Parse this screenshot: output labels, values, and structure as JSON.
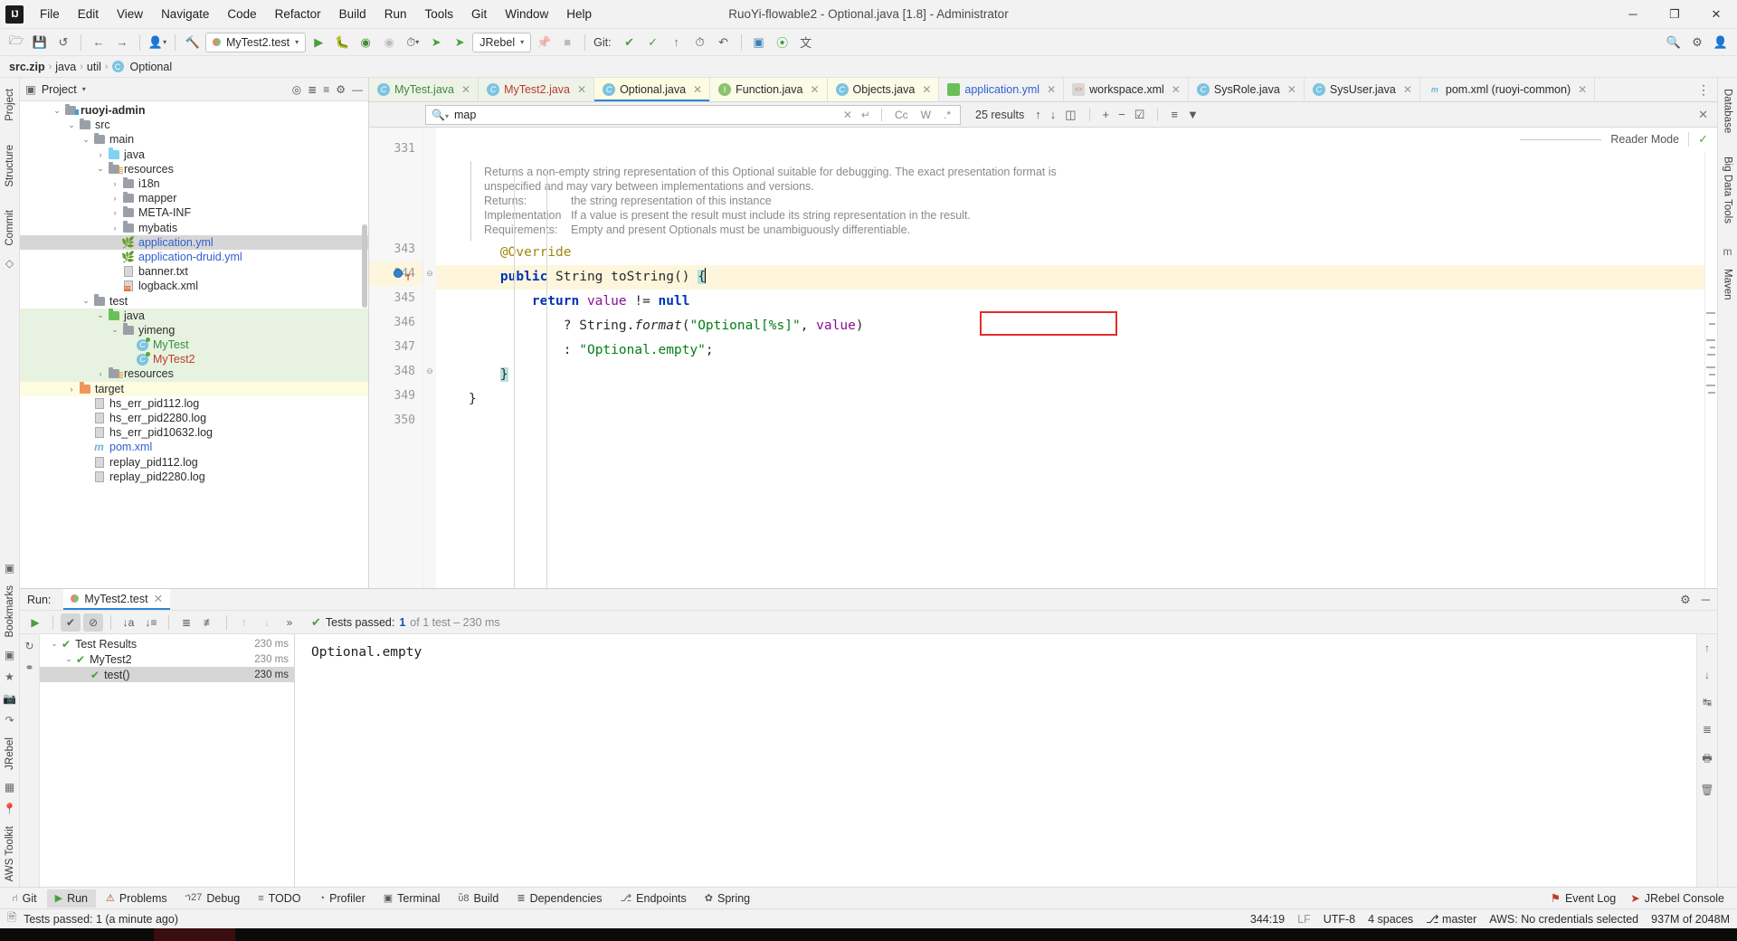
{
  "window": {
    "title": "RuoYi-flowable2 - Optional.java [1.8] - Administrator",
    "logo": "IJ",
    "minimize": "─",
    "maximize": "❐",
    "close": "✕"
  },
  "menubar": [
    "File",
    "Edit",
    "View",
    "Navigate",
    "Code",
    "Refactor",
    "Build",
    "Run",
    "Tools",
    "Git",
    "Window",
    "Help"
  ],
  "toolbar": {
    "open_icon": "open-folder-icon",
    "save_icon": "save-icon",
    "sync_icon": "sync-icon",
    "back_icon": "←",
    "forward_icon": "→",
    "profile_icon": "user-profile-icon",
    "build_icon": "hammer-icon",
    "run_config": "MyTest2.test",
    "run_icon": "▶",
    "debug_icon": "debug-bug-icon",
    "run_coverage_icon": "run-with-coverage-icon",
    "profile_run_icon": "profiler-icon",
    "rerun_icon": "rerun-clock-icon",
    "jrebel_run_icon": "jrebel-run-icon",
    "jrebel_debug_icon": "jrebel-debug-icon",
    "jrebel_label": "JRebel",
    "stop_icon": "■",
    "git_label": "Git:",
    "git_update_icon": "✔",
    "git_commit_icon": "✓",
    "git_push_icon": "↑",
    "git_history_icon": "history-icon",
    "git_rollback_icon": "↶",
    "search_everywhere_icon": "search-icon",
    "settings_icon": "gear-icon",
    "layout_icon": "layout-icon",
    "translate_icon": "translate-icon",
    "checkstyle_icon": "checkmark-circle-icon"
  },
  "breadcrumb": {
    "items": [
      "src.zip",
      "java",
      "util",
      "Optional"
    ],
    "separator": "›"
  },
  "left_strip": [
    "Project",
    "Structure",
    "Commit"
  ],
  "right_strip": [
    "Database",
    "Big Data Tools",
    "Maven"
  ],
  "bottom_left_strip": [
    "Bookmarks",
    "JRebel",
    "AWS Toolkit"
  ],
  "project_panel": {
    "title": "Project",
    "chevron": "▾",
    "icons": [
      "locate-icon",
      "collapse-all-icon",
      "expand-icon",
      "gear-icon",
      "hide-icon"
    ],
    "tree": [
      {
        "indent": 1,
        "arrow": "⌄",
        "icon": "folder-module",
        "label": "ruoyi-admin",
        "style": "bold",
        "color": "dark",
        "state": "normal"
      },
      {
        "indent": 2,
        "arrow": "⌄",
        "icon": "folder",
        "label": "src",
        "color": "dark",
        "state": "normal"
      },
      {
        "indent": 3,
        "arrow": "⌄",
        "icon": "folder",
        "label": "main",
        "color": "dark",
        "state": "normal"
      },
      {
        "indent": 4,
        "arrow": "›",
        "icon": "folder-blue",
        "label": "java",
        "color": "dark",
        "state": "normal"
      },
      {
        "indent": 4,
        "arrow": "⌄",
        "icon": "folder-resources",
        "label": "resources",
        "color": "dark",
        "state": "normal"
      },
      {
        "indent": 5,
        "arrow": "›",
        "icon": "folder",
        "label": "i18n",
        "color": "dark",
        "state": "normal"
      },
      {
        "indent": 5,
        "arrow": "›",
        "icon": "folder",
        "label": "mapper",
        "color": "dark",
        "state": "normal"
      },
      {
        "indent": 5,
        "arrow": "›",
        "icon": "folder",
        "label": "META-INF",
        "color": "dark",
        "state": "normal"
      },
      {
        "indent": 5,
        "arrow": "›",
        "icon": "folder",
        "label": "mybatis",
        "color": "dark",
        "state": "normal"
      },
      {
        "indent": 5,
        "arrow": "",
        "icon": "yml-file",
        "label": "application.yml",
        "color": "blue",
        "state": "selected"
      },
      {
        "indent": 5,
        "arrow": "",
        "icon": "yml-file",
        "label": "application-druid.yml",
        "color": "blue",
        "state": "normal"
      },
      {
        "indent": 5,
        "arrow": "",
        "icon": "txt-file",
        "label": "banner.txt",
        "color": "dark",
        "state": "normal"
      },
      {
        "indent": 5,
        "arrow": "",
        "icon": "xml-file",
        "label": "logback.xml",
        "color": "dark",
        "state": "normal"
      },
      {
        "indent": 3,
        "arrow": "⌄",
        "icon": "folder",
        "label": "test",
        "color": "dark",
        "state": "normal"
      },
      {
        "indent": 4,
        "arrow": "⌄",
        "icon": "folder-green",
        "label": "java",
        "color": "dark",
        "state": "green"
      },
      {
        "indent": 5,
        "arrow": "⌄",
        "icon": "folder-package",
        "label": "yimeng",
        "color": "dark",
        "state": "green"
      },
      {
        "indent": 6,
        "arrow": "",
        "icon": "class-test",
        "label": "MyTest",
        "color": "green",
        "state": "green"
      },
      {
        "indent": 6,
        "arrow": "",
        "icon": "class-test",
        "label": "MyTest2",
        "color": "red",
        "state": "green"
      },
      {
        "indent": 4,
        "arrow": "›",
        "icon": "folder-test-resources",
        "label": "resources",
        "color": "dark",
        "state": "green"
      },
      {
        "indent": 2,
        "arrow": "›",
        "icon": "folder-orange",
        "label": "target",
        "color": "dark",
        "state": "yellow"
      },
      {
        "indent": 3,
        "arrow": "",
        "icon": "log-file",
        "label": "hs_err_pid112.log",
        "color": "dark",
        "state": "normal"
      },
      {
        "indent": 3,
        "arrow": "",
        "icon": "log-file",
        "label": "hs_err_pid2280.log",
        "color": "dark",
        "state": "normal"
      },
      {
        "indent": 3,
        "arrow": "",
        "icon": "log-file",
        "label": "hs_err_pid10632.log",
        "color": "dark",
        "state": "normal"
      },
      {
        "indent": 3,
        "arrow": "",
        "icon": "maven-file",
        "label": "pom.xml",
        "color": "blue",
        "state": "normal"
      },
      {
        "indent": 3,
        "arrow": "",
        "icon": "log-file",
        "label": "replay_pid112.log",
        "color": "dark",
        "state": "normal"
      },
      {
        "indent": 3,
        "arrow": "",
        "icon": "log-file",
        "label": "replay_pid2280.log",
        "color": "dark",
        "state": "normal"
      }
    ]
  },
  "editor_tabs": [
    {
      "label": "MyTest.java",
      "icon": "class-test-icon",
      "color": "green",
      "bg": "green",
      "active": false
    },
    {
      "label": "MyTest2.java",
      "icon": "class-test-icon",
      "color": "red",
      "bg": "green",
      "active": false
    },
    {
      "label": "Optional.java",
      "icon": "class-lib-icon",
      "color": "dark",
      "bg": "yellow",
      "active": true
    },
    {
      "label": "Function.java",
      "icon": "interface-icon",
      "color": "dark",
      "bg": "yellow",
      "active": false
    },
    {
      "label": "Objects.java",
      "icon": "class-lib-icon",
      "color": "dark",
      "bg": "yellow",
      "active": false
    },
    {
      "label": "application.yml",
      "icon": "yml-icon",
      "color": "blue",
      "bg": "plain",
      "active": false
    },
    {
      "label": "workspace.xml",
      "icon": "xml-icon",
      "color": "dark",
      "bg": "plain",
      "active": false
    },
    {
      "label": "SysRole.java",
      "icon": "class-icon",
      "color": "dark",
      "bg": "plain",
      "active": false
    },
    {
      "label": "SysUser.java",
      "icon": "class-icon",
      "color": "dark",
      "bg": "plain",
      "active": false
    },
    {
      "label": "pom.xml (ruoyi-common)",
      "icon": "maven-icon",
      "color": "dark",
      "bg": "plain",
      "active": false
    }
  ],
  "tabs_overflow_icon": "⋮",
  "search": {
    "icon": "search-icon",
    "value": "map",
    "placeholder": "Search",
    "clear_icon": "✕",
    "history_icon": "↵",
    "match_case": "Cc",
    "words": "W",
    "regex": ".*",
    "results": "25 results",
    "prev_icon": "↑",
    "next_icon": "↓",
    "select_all_icon": "select-all-icon",
    "add_line_icon": "add-occurrence-icon",
    "remove_line_icon": "remove-occurrence-icon",
    "select_occurrences_icon": "select-occurrences-icon",
    "in_selection_icon": "in-selection-icon",
    "filter_icon": "filter-icon",
    "close_icon": "✕"
  },
  "reader_mode": {
    "label": "Reader Mode",
    "status_icon": "inspections-ok-icon"
  },
  "code": {
    "doc": {
      "paragraph": "Returns a non-empty string representation of this Optional suitable for debugging. The exact presentation format is unspecified and may vary between implementations and versions.",
      "returns_key": "Returns:",
      "returns_val": "the string representation of this instance",
      "impl_key_1": "Implementation",
      "impl_key_2": "Requirements:",
      "impl_val_1": "If a value is present the result must include its string representation in the result.",
      "impl_val_2": "Empty and present Optionals must be unambiguously differentiable."
    },
    "first_line_number": 331,
    "lines": [
      {
        "num": 343,
        "tokens": [
          {
            "t": "@Override",
            "c": "ann"
          }
        ],
        "indent": 4
      },
      {
        "num": 344,
        "tokens": [
          {
            "t": "public ",
            "c": "kw"
          },
          {
            "t": "String ",
            "c": "plain"
          },
          {
            "t": "toString",
            "c": "plain"
          },
          {
            "t": "() ",
            "c": "plain"
          },
          {
            "t": "{",
            "c": "brace"
          }
        ],
        "indent": 4,
        "highlight": true,
        "breakpoint": true
      },
      {
        "num": 345,
        "tokens": [
          {
            "t": "return ",
            "c": "kw"
          },
          {
            "t": "value",
            "c": "fld"
          },
          {
            "t": " != ",
            "c": "plain"
          },
          {
            "t": "null",
            "c": "kw"
          }
        ],
        "indent": 8
      },
      {
        "num": 346,
        "tokens": [
          {
            "t": "? String.",
            "c": "plain"
          },
          {
            "t": "format",
            "c": "ital"
          },
          {
            "t": "(",
            "c": "plain"
          },
          {
            "t": "\"Optional[%s]\"",
            "c": "str"
          },
          {
            "t": ", ",
            "c": "plain"
          },
          {
            "t": "value",
            "c": "fld"
          },
          {
            "t": ")",
            "c": "plain"
          }
        ],
        "indent": 12
      },
      {
        "num": 347,
        "tokens": [
          {
            "t": ": ",
            "c": "plain"
          },
          {
            "t": "\"Optional.empty\"",
            "c": "str"
          },
          {
            "t": ";",
            "c": "plain"
          }
        ],
        "indent": 12,
        "boxed": true
      },
      {
        "num": 348,
        "tokens": [
          {
            "t": "}",
            "c": "brace"
          }
        ],
        "indent": 4
      },
      {
        "num": 349,
        "tokens": [
          {
            "t": "}",
            "c": "plain"
          }
        ],
        "indent": 0
      },
      {
        "num": 350,
        "tokens": [],
        "indent": 0
      }
    ]
  },
  "run_panel": {
    "label": "Run:",
    "tab": "MyTest2.test",
    "tab_close": "✕",
    "settings_icon": "gear-icon",
    "hide_icon": "─",
    "toolbar": {
      "rerun_icon": "▶",
      "show_passed_icon": "✔",
      "ignore_icon": "⊘",
      "sort_alpha_icon": "sort-alphabetically-icon",
      "sort_duration_icon": "sort-by-duration-icon",
      "expand_all_icon": "expand-all-icon",
      "collapse_all_icon": "collapse-all-icon",
      "prev_icon": "↑",
      "next_icon": "↓",
      "more_icon": "»"
    },
    "status": {
      "check": "✔",
      "prefix": "Tests passed:",
      "count": "1",
      "suffix": "of 1 test – 230 ms"
    },
    "tree": [
      {
        "indent": 0,
        "arrow": "⌄",
        "label": "Test Results",
        "time": "230 ms",
        "selected": false
      },
      {
        "indent": 1,
        "arrow": "⌄",
        "label": "MyTest2",
        "time": "230 ms",
        "selected": false
      },
      {
        "indent": 2,
        "arrow": "",
        "label": "test()",
        "time": "230 ms",
        "selected": true
      }
    ],
    "console_output": "Optional.empty",
    "left_icons": [
      "rerun-failed-icon",
      "toggle-auto-test-icon"
    ],
    "right_icons": [
      "scroll-up-icon",
      "scroll-down-icon",
      "soft-wrap-icon",
      "scroll-to-end-icon",
      "print-icon",
      "clear-all-icon"
    ]
  },
  "bottom_tabs": [
    {
      "label": "Git",
      "icon": "branch-icon",
      "active": false
    },
    {
      "label": "Run",
      "icon": "run-icon",
      "active": true
    },
    {
      "label": "Problems",
      "icon": "problems-icon",
      "active": false
    },
    {
      "label": "Debug",
      "icon": "debug-icon",
      "active": false
    },
    {
      "label": "TODO",
      "icon": "todo-icon",
      "active": false
    },
    {
      "label": "Profiler",
      "icon": "profiler-icon",
      "active": false
    },
    {
      "label": "Terminal",
      "icon": "terminal-icon",
      "active": false
    },
    {
      "label": "Build",
      "icon": "build-icon",
      "active": false
    },
    {
      "label": "Dependencies",
      "icon": "dependencies-icon",
      "active": false
    },
    {
      "label": "Endpoints",
      "icon": "endpoints-icon",
      "active": false
    },
    {
      "label": "Spring",
      "icon": "spring-icon",
      "active": false
    }
  ],
  "bottom_right": [
    {
      "label": "Event Log",
      "icon": "event-log-icon"
    },
    {
      "label": "JRebel Console",
      "icon": "jrebel-icon"
    }
  ],
  "statusbar": {
    "icon": "message-icon",
    "message": "Tests passed: 1 (a minute ago)",
    "caret": "344:19",
    "line_sep": "LF",
    "encoding": "UTF-8",
    "indent": "4 spaces",
    "branch_icon": "branch-icon",
    "branch": "master",
    "aws": "AWS: No credentials selected",
    "memory": "937M of 2048M"
  }
}
